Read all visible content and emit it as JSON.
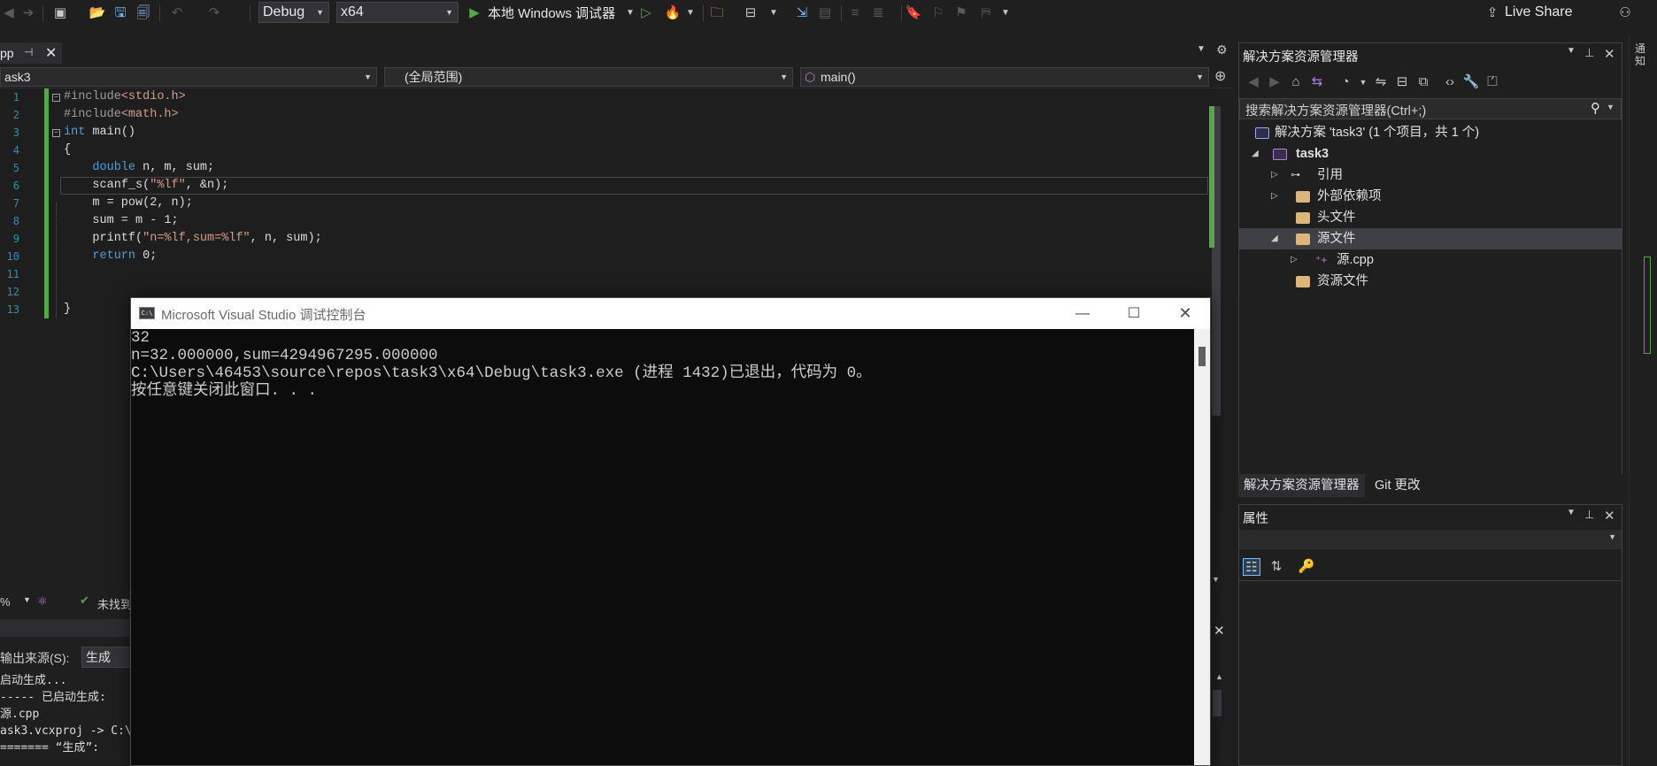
{
  "toolbar": {
    "config": "Debug",
    "platform": "x64",
    "run_label": "本地 Windows 调试器",
    "live_share": "Live Share"
  },
  "document": {
    "tab_label": "pp",
    "project_combo": "ask3",
    "scope_combo": "(全局范围)",
    "member_combo": "main()"
  },
  "editor": {
    "lines": [
      {
        "num": "1",
        "segments": [
          {
            "cls": "pp",
            "text": "#include"
          },
          {
            "cls": "str",
            "text": "<stdio.h>"
          }
        ]
      },
      {
        "num": "2",
        "segments": [
          {
            "cls": "pp",
            "text": "#include"
          },
          {
            "cls": "str",
            "text": "<math.h>"
          }
        ]
      },
      {
        "num": "3",
        "segments": [
          {
            "cls": "kw",
            "text": "int"
          },
          {
            "cls": "",
            "text": " main()"
          }
        ]
      },
      {
        "num": "4",
        "segments": [
          {
            "cls": "",
            "text": "{"
          }
        ]
      },
      {
        "num": "5",
        "segments": [
          {
            "cls": "",
            "text": "    "
          },
          {
            "cls": "kw",
            "text": "double"
          },
          {
            "cls": "",
            "text": " n, m, sum;"
          }
        ]
      },
      {
        "num": "6",
        "segments": [
          {
            "cls": "",
            "text": "    scanf_s("
          },
          {
            "cls": "str",
            "text": "\"%lf\""
          },
          {
            "cls": "",
            "text": ", &n);"
          }
        ]
      },
      {
        "num": "7",
        "segments": [
          {
            "cls": "",
            "text": "    m = pow(2, n);"
          }
        ]
      },
      {
        "num": "8",
        "segments": [
          {
            "cls": "",
            "text": "    sum = m - 1;"
          }
        ]
      },
      {
        "num": "9",
        "segments": [
          {
            "cls": "",
            "text": "    printf("
          },
          {
            "cls": "str",
            "text": "\"n=%lf,sum=%lf\""
          },
          {
            "cls": "",
            "text": ", n, sum);"
          }
        ]
      },
      {
        "num": "10",
        "segments": [
          {
            "cls": "",
            "text": "    "
          },
          {
            "cls": "kw",
            "text": "return"
          },
          {
            "cls": "",
            "text": " 0;"
          }
        ]
      },
      {
        "num": "11",
        "segments": []
      },
      {
        "num": "12",
        "segments": []
      },
      {
        "num": "13",
        "segments": [
          {
            "cls": "",
            "text": "}"
          }
        ]
      }
    ]
  },
  "status": {
    "zoom": "%",
    "issues": "未找到"
  },
  "output": {
    "source_label": "输出来源(S):",
    "source_value": "生成",
    "lines": [
      "启动生成...",
      "----- 已启动生成: ",
      "源.cpp",
      "ask3.vcxproj -> C:\\",
      "======= “生成”: "
    ]
  },
  "solution_explorer": {
    "title": "解决方案资源管理器",
    "search_placeholder": "搜索解决方案资源管理器(Ctrl+;)",
    "solution_label": "解决方案 'task3' (1 个项目，共 1 个)",
    "project": "task3",
    "items": {
      "references": "引用",
      "external_deps": "外部依赖项",
      "header_files": "头文件",
      "source_files": "源文件",
      "source_cpp": "源.cpp",
      "resource_files": "资源文件"
    },
    "tabs": [
      "解决方案资源管理器",
      "Git 更改"
    ]
  },
  "properties": {
    "title": "属性"
  },
  "right_rail": {
    "label": "通知"
  },
  "console": {
    "title": "Microsoft Visual Studio 调试控制台",
    "lines": [
      "32",
      "n=32.000000,sum=4294967295.000000",
      "C:\\Users\\46453\\source\\repos\\task3\\x64\\Debug\\task3.exe (进程 1432)已退出，代码为 0。",
      "按任意键关闭此窗口. . ."
    ]
  },
  "colors": {
    "accent_green": "#57a64a",
    "keyword": "#569cd6",
    "string": "#d69d85",
    "line_number": "#2b91af"
  }
}
